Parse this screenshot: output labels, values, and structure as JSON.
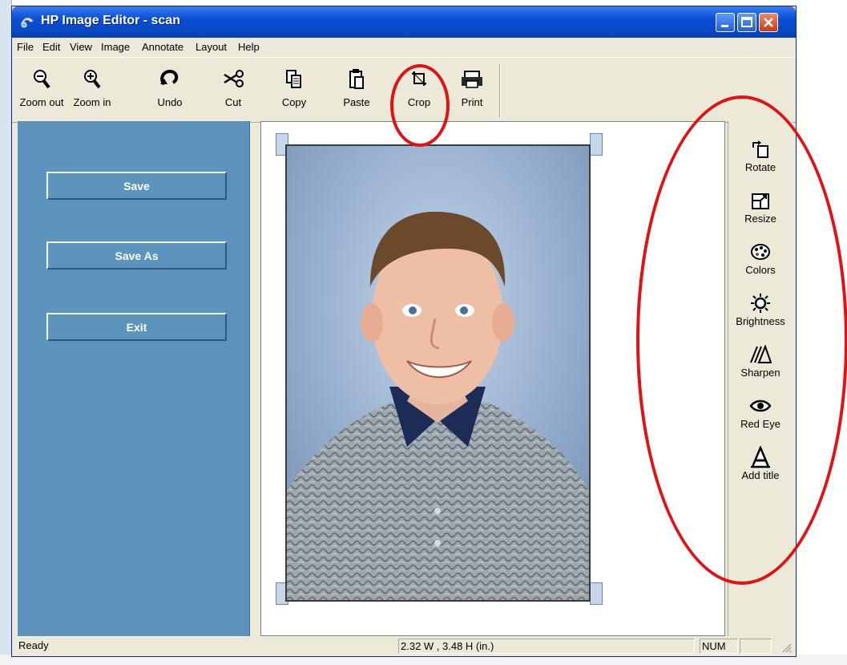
{
  "window": {
    "title": "HP Image Editor - scan"
  },
  "menu": [
    "File",
    "Edit",
    "View",
    "Image",
    "Annotate",
    "Layout",
    "Help"
  ],
  "toolbar": [
    {
      "label": "Zoom out",
      "icon": "zoom-out-icon"
    },
    {
      "label": "Zoom in",
      "icon": "zoom-in-icon"
    },
    {
      "label": "Undo",
      "icon": "undo-icon"
    },
    {
      "label": "Cut",
      "icon": "scissors-icon"
    },
    {
      "label": "Copy",
      "icon": "copy-icon"
    },
    {
      "label": "Paste",
      "icon": "paste-icon"
    },
    {
      "label": "Crop",
      "icon": "crop-icon"
    },
    {
      "label": "Print",
      "icon": "printer-icon"
    }
  ],
  "left_panel": {
    "buttons": [
      "Save",
      "Save As",
      "Exit"
    ]
  },
  "right_panel": {
    "tools": [
      {
        "label": "Rotate",
        "icon": "rotate-icon"
      },
      {
        "label": "Resize",
        "icon": "resize-icon"
      },
      {
        "label": "Colors",
        "icon": "palette-icon"
      },
      {
        "label": "Brightness",
        "icon": "sun-icon"
      },
      {
        "label": "Sharpen",
        "icon": "sharpen-icon"
      },
      {
        "label": "Red Eye",
        "icon": "eye-icon"
      },
      {
        "label": "Add title",
        "icon": "text-a-icon"
      }
    ]
  },
  "statusbar": {
    "status": "Ready",
    "dimensions": "2.32 W , 3.48 H  (in.)",
    "num": "NUM"
  },
  "colors": {
    "annotation": "#e31212",
    "left_panel": "#5c94bd",
    "titlebar": "#0a4fd6"
  }
}
